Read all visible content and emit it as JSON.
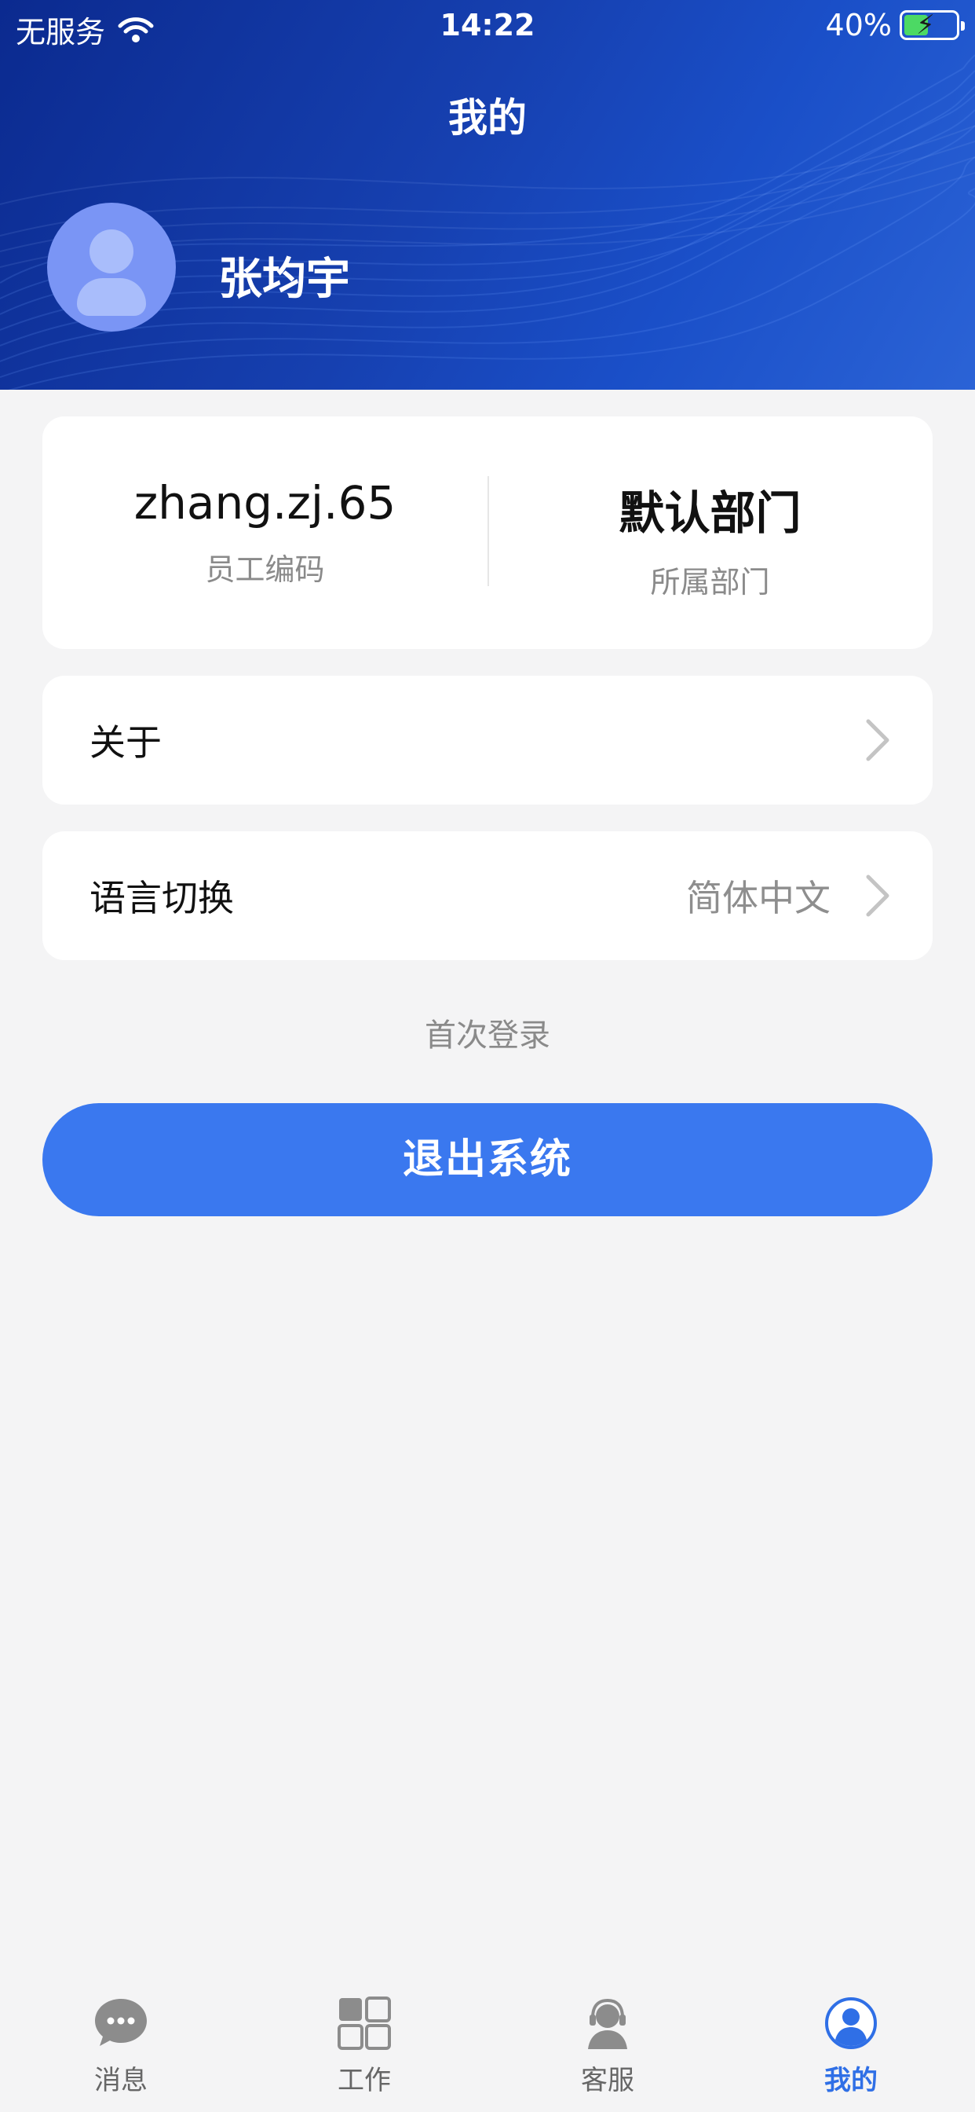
{
  "status_bar": {
    "carrier": "无服务",
    "time": "14:22",
    "battery": "40%",
    "battery_level": 0.4
  },
  "header": {
    "title": "我的",
    "username": "张均宇"
  },
  "info": {
    "employee_code": {
      "value": "zhang.zj.65",
      "label": "员工编码"
    },
    "department": {
      "value": "默认部门",
      "label": "所属部门"
    }
  },
  "menu": {
    "about": {
      "label": "关于"
    },
    "language": {
      "label": "语言切换",
      "value": "简体中文"
    }
  },
  "first_login": "首次登录",
  "logout_label": "退出系统",
  "tabs": [
    {
      "label": "消息",
      "icon": "message-icon"
    },
    {
      "label": "工作",
      "icon": "grid-icon"
    },
    {
      "label": "客服",
      "icon": "support-icon"
    },
    {
      "label": "我的",
      "icon": "user-icon",
      "active": true
    }
  ],
  "colors": {
    "accent": "#3a78ef",
    "active_tab": "#2f6fe6",
    "header": "#1640b0"
  }
}
